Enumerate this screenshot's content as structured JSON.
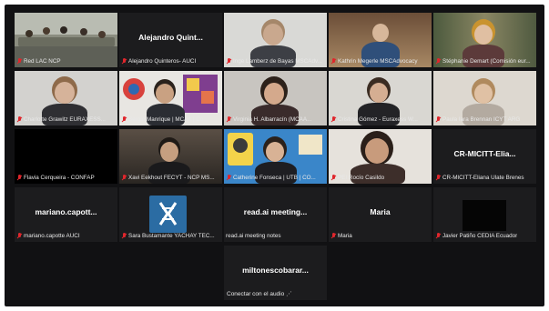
{
  "meeting": {
    "tiles": [
      {
        "id": "t1",
        "label": "Red LAC NCP",
        "video": "room",
        "muted": true
      },
      {
        "id": "t2",
        "label": "Alejandro Quinteros- AUCI",
        "center": "Alejandro Quint...",
        "video": "off",
        "muted": true
      },
      {
        "id": "t3",
        "label": "Inge Lamberz de Bayas MSCAdv...",
        "video": "person",
        "muted": true
      },
      {
        "id": "t4",
        "label": "Kathrin Megerle MSCAdvocacy",
        "video": "person",
        "muted": true
      },
      {
        "id": "t5",
        "label": "Stéphanie Demart (Comisión eur...",
        "video": "person",
        "muted": true,
        "active": true
      },
      {
        "id": "t6",
        "label": "Charlotte Grawitz EURAXESS...",
        "video": "person",
        "muted": true
      },
      {
        "id": "t7",
        "label": "Sergio Manrique | MCAA | Co...",
        "video": "alumni",
        "muted": true
      },
      {
        "id": "t8",
        "label": "Virginia H. Albarracín (MCAA...",
        "video": "person",
        "muted": true
      },
      {
        "id": "t9",
        "label": "Cristina Gómez - Euraxess W...",
        "video": "person",
        "muted": true
      },
      {
        "id": "t10",
        "label": "Paula Iara Brennan ICYT ARG",
        "video": "person",
        "muted": true
      },
      {
        "id": "t11",
        "label": "Flavia Cerqueira - CONFAP",
        "video": "off",
        "muted": true
      },
      {
        "id": "t12",
        "label": "Xavi Eekhout FECYT - NCP MS...",
        "video": "person",
        "muted": true
      },
      {
        "id": "t13",
        "label": "Catherine Fonseca | UTB | CO...",
        "video": "poster",
        "muted": true
      },
      {
        "id": "t14",
        "label": "PEI Rocío Casildo",
        "video": "person",
        "muted": true
      },
      {
        "id": "t15",
        "label": "CR-MICITT-Eliana Ulate Brenes",
        "center": "CR-MICITT-Elia...",
        "video": "off",
        "muted": true
      },
      {
        "id": "t16",
        "label": "mariano.capotte AUCI",
        "center": "mariano.capott...",
        "video": "off",
        "muted": true
      },
      {
        "id": "t17",
        "label": "Sara Bustamante YACHAY TEC...",
        "video": "logo",
        "muted": true
      },
      {
        "id": "t18",
        "label": "read.ai meeting notes",
        "center": "read.ai meeting...",
        "video": "off",
        "muted": false
      },
      {
        "id": "t19",
        "label": "Maria",
        "center": "Maria",
        "video": "off",
        "muted": true
      },
      {
        "id": "t20",
        "label": "Javier Patiño CEDIA Ecuador",
        "video": "dark",
        "muted": true
      },
      {
        "id": "t21",
        "label": "",
        "video": "empty"
      },
      {
        "id": "t22",
        "label": "",
        "video": "empty"
      },
      {
        "id": "t23",
        "label": "Conectar con el audio",
        "center": "miltonescobarar...",
        "video": "off",
        "muted": false,
        "connecting": true
      },
      {
        "id": "t24",
        "label": "",
        "video": "empty"
      },
      {
        "id": "t25",
        "label": "",
        "video": "empty"
      }
    ]
  },
  "colors": {
    "background": "#111113",
    "tile": "#1c1c1e",
    "active_speaker": "#2fc52f",
    "muted": "#e0262c"
  }
}
